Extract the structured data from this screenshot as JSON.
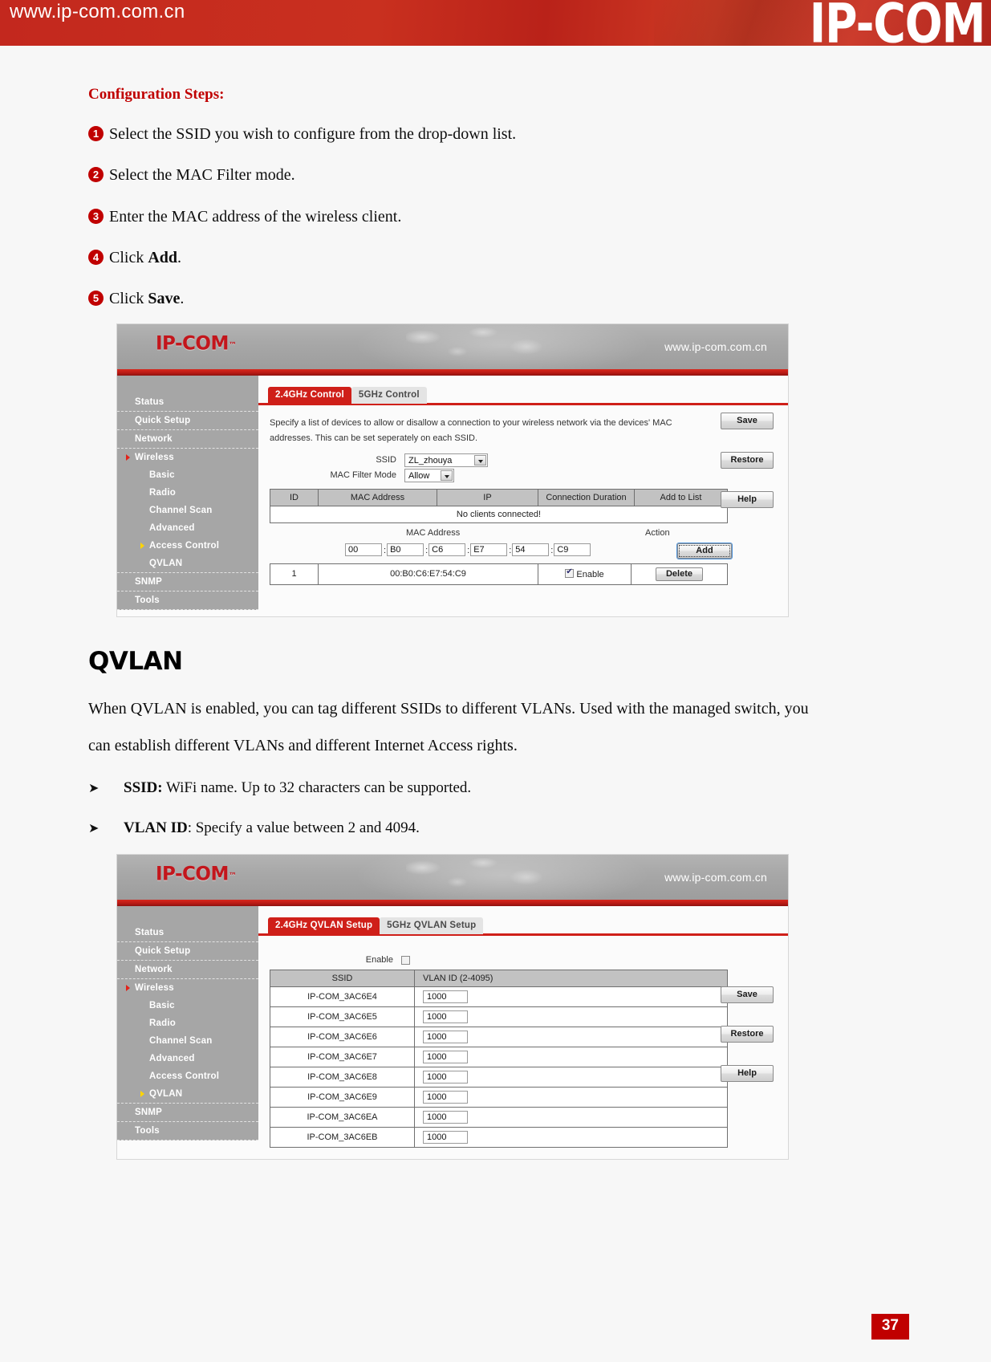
{
  "banner": {
    "url": "www.ip-com.com.cn",
    "logo": "IP-COM"
  },
  "doc": {
    "config_steps_title": "Configuration Steps:",
    "steps": [
      {
        "num": "1",
        "text": "Select the SSID you wish to configure from the drop-down list."
      },
      {
        "num": "2",
        "text": "Select the MAC Filter mode."
      },
      {
        "num": "3",
        "text": "Enter the MAC address of the wireless client."
      },
      {
        "num": "4",
        "text": "Click ",
        "bold": "Add",
        "tail": "."
      },
      {
        "num": "5",
        "text": "Click ",
        "bold": "Save",
        "tail": "."
      }
    ],
    "qvlan_heading": "QVLAN",
    "qvlan_para_line1": "When QVLAN is enabled, you can tag different SSIDs to different VLANs. Used with the managed switch, you",
    "qvlan_para_line2": "can establish different VLANs and different Internet Access rights.",
    "bullets": [
      {
        "glyph": "➤",
        "term": "SSID:",
        "rest": " WiFi name. Up to 32 characters can be supported."
      },
      {
        "glyph": "➤",
        "term": "VLAN ID",
        "rest": ": Specify a value between 2 and 4094."
      }
    ],
    "page_number": "37"
  },
  "ui_access_control": {
    "logo": "IP-COM",
    "logo_tm": "™",
    "url": "www.ip-com.com.cn",
    "sidebar": [
      {
        "label": "Status",
        "sub": false,
        "arrow": false
      },
      {
        "label": "Quick Setup",
        "sub": false,
        "arrow": false
      },
      {
        "label": "Network",
        "sub": false,
        "arrow": false
      },
      {
        "label": "Wireless",
        "sub": false,
        "arrow": true
      },
      {
        "label": "Basic",
        "sub": true,
        "arrow": false
      },
      {
        "label": "Radio",
        "sub": true,
        "arrow": false
      },
      {
        "label": "Channel Scan",
        "sub": true,
        "arrow": false
      },
      {
        "label": "Advanced",
        "sub": true,
        "arrow": false
      },
      {
        "label": "Access Control",
        "sub": true,
        "arrow": true
      },
      {
        "label": "QVLAN",
        "sub": true,
        "arrow": false
      },
      {
        "label": "SNMP",
        "sub": false,
        "arrow": false
      },
      {
        "label": "Tools",
        "sub": false,
        "arrow": false
      }
    ],
    "tabs": [
      {
        "label": "2.4GHz Control",
        "active": true
      },
      {
        "label": "5GHz Control",
        "active": false
      }
    ],
    "description": "Specify a list of devices to allow or disallow a connection to your wireless network via the devices' MAC addresses. This can be set seperately on each SSID.",
    "fields": {
      "ssid_label": "SSID",
      "ssid_value": "ZL_zhouya",
      "mac_filter_label": "MAC Filter Mode",
      "mac_filter_value": "Allow"
    },
    "client_table": {
      "headers": [
        "ID",
        "MAC Address",
        "IP",
        "Connection Duration",
        "Add to List"
      ],
      "empty_message": "No clients connected!"
    },
    "entry_section": {
      "mac_header": "MAC Address",
      "action_header": "Action",
      "octets": [
        "00",
        "B0",
        "C6",
        "E7",
        "54",
        "C9"
      ],
      "separator": ":",
      "add_button": "Add"
    },
    "list_rows": [
      {
        "id": "1",
        "mac": "00:B0:C6:E7:54:C9",
        "enable_label": "Enable",
        "enabled": true,
        "delete_button": "Delete"
      }
    ],
    "side_buttons": [
      "Save",
      "Restore",
      "Help"
    ]
  },
  "ui_qvlan": {
    "logo": "IP-COM",
    "logo_tm": "™",
    "url": "www.ip-com.com.cn",
    "sidebar": [
      {
        "label": "Status",
        "sub": false,
        "arrow": false
      },
      {
        "label": "Quick Setup",
        "sub": false,
        "arrow": false
      },
      {
        "label": "Network",
        "sub": false,
        "arrow": false
      },
      {
        "label": "Wireless",
        "sub": false,
        "arrow": true
      },
      {
        "label": "Basic",
        "sub": true,
        "arrow": false
      },
      {
        "label": "Radio",
        "sub": true,
        "arrow": false
      },
      {
        "label": "Channel Scan",
        "sub": true,
        "arrow": false
      },
      {
        "label": "Advanced",
        "sub": true,
        "arrow": false
      },
      {
        "label": "Access Control",
        "sub": true,
        "arrow": false
      },
      {
        "label": "QVLAN",
        "sub": true,
        "arrow": true
      },
      {
        "label": "SNMP",
        "sub": false,
        "arrow": false
      },
      {
        "label": "Tools",
        "sub": false,
        "arrow": false
      }
    ],
    "tabs": [
      {
        "label": "2.4GHz QVLAN Setup",
        "active": true
      },
      {
        "label": "5GHz QVLAN Setup",
        "active": false
      }
    ],
    "enable_label": "Enable",
    "enable_checked": false,
    "table": {
      "headers": [
        "SSID",
        "VLAN ID (2-4095)"
      ],
      "rows": [
        {
          "ssid": "IP-COM_3AC6E4",
          "vlan_id": "1000"
        },
        {
          "ssid": "IP-COM_3AC6E5",
          "vlan_id": "1000"
        },
        {
          "ssid": "IP-COM_3AC6E6",
          "vlan_id": "1000"
        },
        {
          "ssid": "IP-COM_3AC6E7",
          "vlan_id": "1000"
        },
        {
          "ssid": "IP-COM_3AC6E8",
          "vlan_id": "1000"
        },
        {
          "ssid": "IP-COM_3AC6E9",
          "vlan_id": "1000"
        },
        {
          "ssid": "IP-COM_3AC6EA",
          "vlan_id": "1000"
        },
        {
          "ssid": "IP-COM_3AC6EB",
          "vlan_id": "1000"
        }
      ]
    },
    "side_buttons": [
      "Save",
      "Restore",
      "Help"
    ]
  },
  "colors": {
    "brand_red": "#c3281e",
    "accent_red": "#cf1f19",
    "sidebar_gray": "#a6a6a6"
  }
}
